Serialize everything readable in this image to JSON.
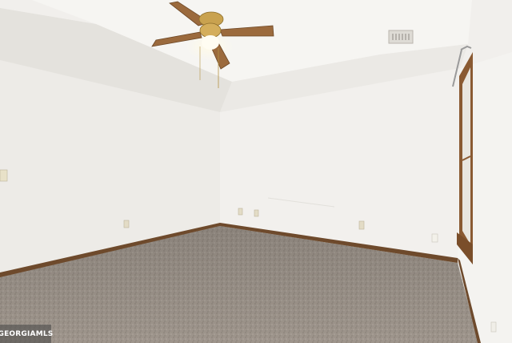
{
  "scene": {
    "description_free": true,
    "colors": {
      "ceiling": "#f1efec",
      "ceiling_tray": "#f6f5f2",
      "wall_left": "#edebe7",
      "wall_back": "#f2f0ed",
      "wall_right": "#f4f3f0",
      "baseboard": "#6e4a2c",
      "carpet": "#9e958c",
      "window_trim": "#8a5a32",
      "fan_wood": "#9b6a3d",
      "fan_brass": "#c9a24f"
    }
  },
  "watermark": {
    "text": "GEORGIAMLS",
    "kind": "logo"
  }
}
